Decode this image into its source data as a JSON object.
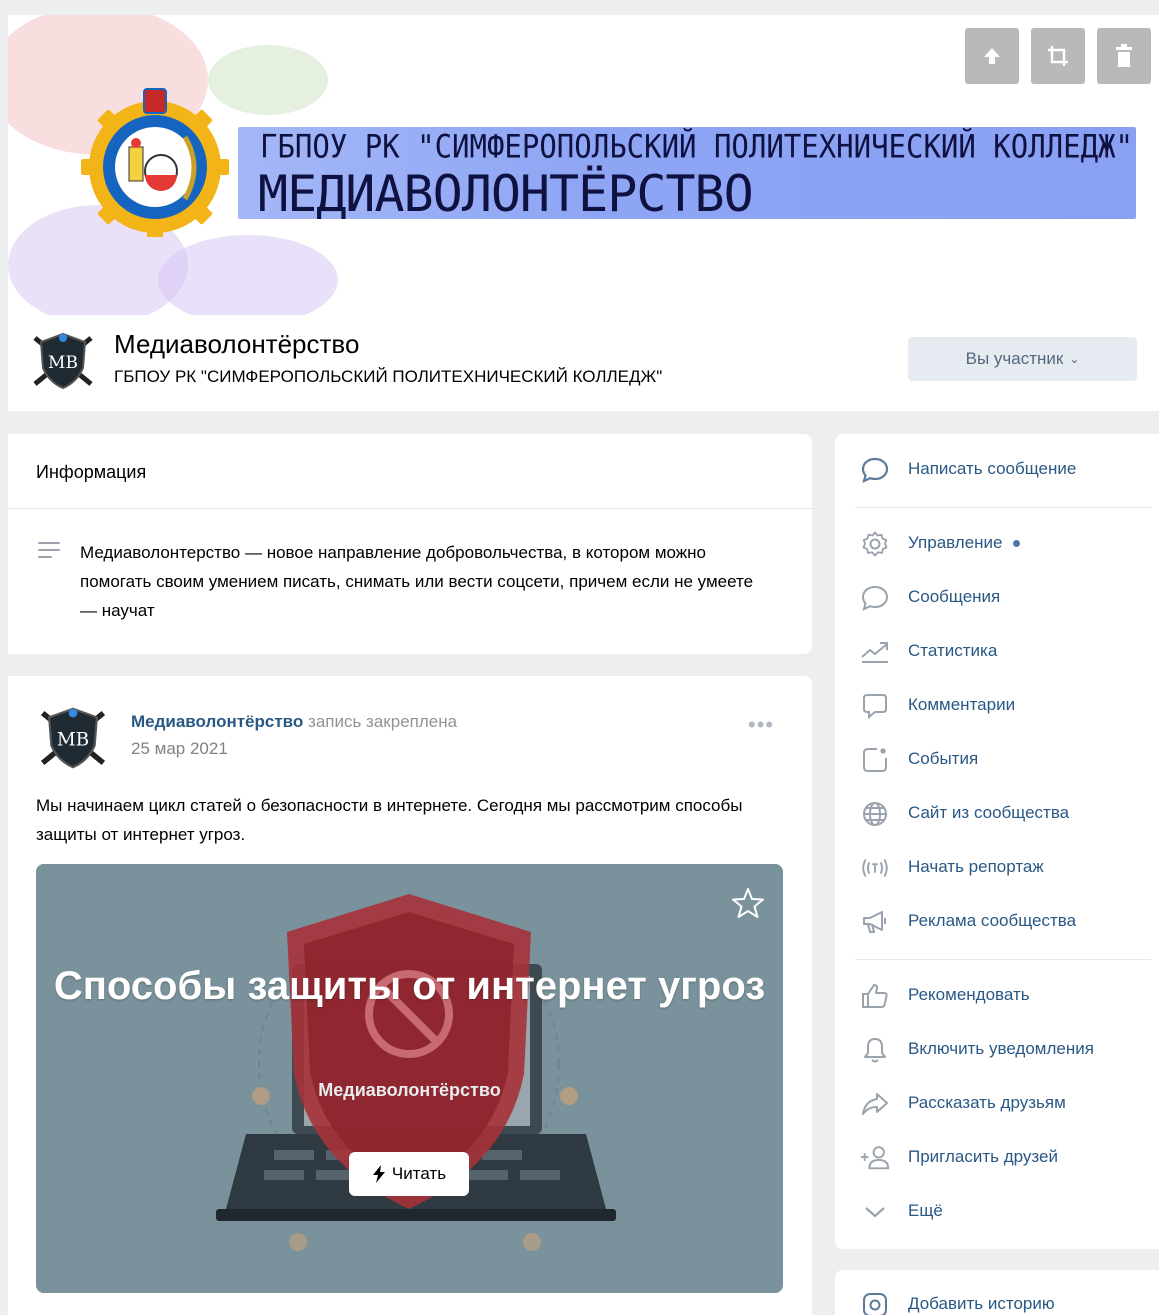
{
  "cover": {
    "line1": "ГБПОУ РК \"СИМФЕРОПОЛЬСКИЙ ПОЛИТЕХНИЧЕСКИЙ КОЛЛЕДЖ\"",
    "line2": "МЕДИАВОЛОНТЁРСТВО",
    "tools": [
      "upload-icon",
      "crop-icon",
      "trash-icon"
    ],
    "tool_color": "#b9b9b9",
    "band_color": "#8ea5f4"
  },
  "group": {
    "name": "Медиаволонтёрство",
    "status": "ГБПОУ РК \"СИМФЕРОПОЛЬСКИЙ ПОЛИТЕХНИЧЕСКИЙ КОЛЛЕДЖ\"",
    "member_button": "Вы участник",
    "avatar_text": "MB"
  },
  "info": {
    "title": "Информация",
    "description": "Медиаволонтерство — новое направление добровольчества, в котором можно помогать своим умением писать, снимать или вести соцсети, причем если не умеете — научат"
  },
  "post": {
    "author": "Медиаволонтёрство",
    "pinned_label": "запись закреплена",
    "date": "25 мар 2021",
    "more": "•••",
    "text": "Мы начинаем цикл статей о безопасности в интернете. Сегодня мы рассмотрим способы защиты от интернет угроз.",
    "article": {
      "title": "Способы защиты от интернет угроз",
      "source": "Медиаволонтёрство",
      "read_button": "Читать"
    }
  },
  "sidebar": {
    "items": [
      {
        "label": "Написать сообщение",
        "icon": "message-icon"
      },
      {
        "label": "Управление",
        "icon": "gear-icon"
      },
      {
        "label": "Сообщения",
        "icon": "chat-icon"
      },
      {
        "label": "Статистика",
        "icon": "stats-icon"
      },
      {
        "label": "Комментарии",
        "icon": "comment-icon"
      },
      {
        "label": "События",
        "icon": "events-icon"
      },
      {
        "label": "Сайт из сообщества",
        "icon": "globe-icon"
      },
      {
        "label": "Начать репортаж",
        "icon": "broadcast-icon"
      },
      {
        "label": "Реклама сообщества",
        "icon": "megaphone-icon"
      },
      {
        "label": "Рекомендовать",
        "icon": "thumbs-up-icon"
      },
      {
        "label": "Включить уведомления",
        "icon": "bell-icon"
      },
      {
        "label": "Рассказать друзьям",
        "icon": "share-icon"
      },
      {
        "label": "Пригласить друзей",
        "icon": "add-user-icon"
      },
      {
        "label": "Ещё",
        "icon": "chevron-down-icon"
      }
    ],
    "story": {
      "label": "Добавить историю",
      "icon": "camera-icon"
    },
    "link_color": "#2a5885",
    "icon_color": "#5c7a99"
  }
}
